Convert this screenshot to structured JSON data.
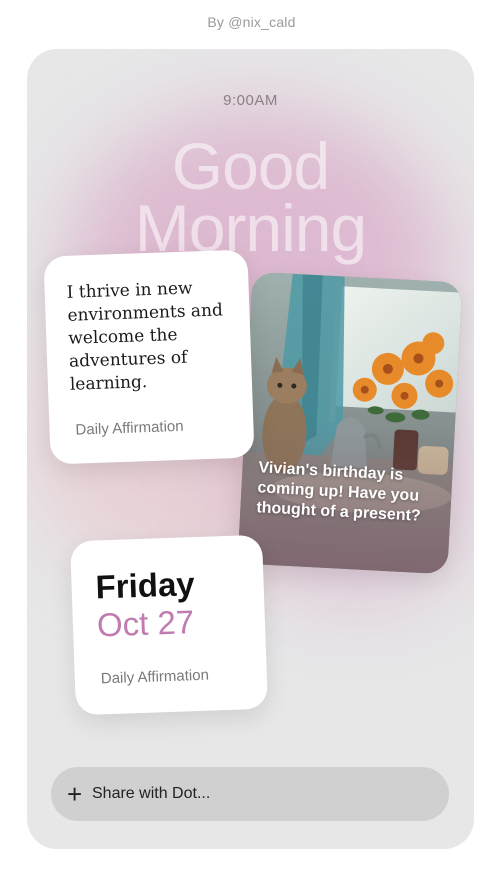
{
  "credit": "By @nix_cald",
  "time": "9:00AM",
  "greeting": {
    "line1": "Good",
    "line2": "Morning"
  },
  "affirmation_card": {
    "quote": "I thrive in new environments and welcome the adventures of learning.",
    "label": "Daily Affirmation"
  },
  "photo_card": {
    "caption": "Vivian's birthday is coming up! Have you thought of a present?",
    "image": "cat-with-sunflowers"
  },
  "date_card": {
    "day": "Friday",
    "date": "Oct 27",
    "label": "Daily Affirmation"
  },
  "share_bar": {
    "icon": "plus-icon",
    "label": "Share with Dot..."
  },
  "colors": {
    "accent": "#c07bb0",
    "glow": "#d696be",
    "background": "#e7e7e8"
  }
}
